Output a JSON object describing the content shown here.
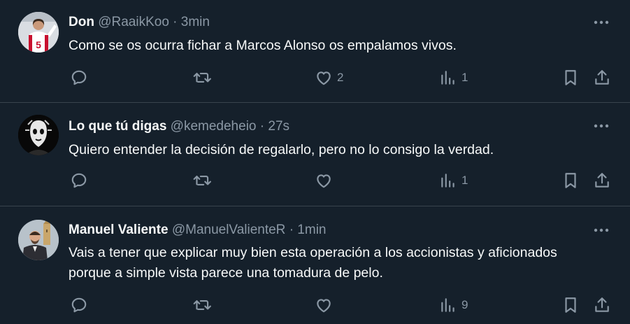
{
  "tweets": [
    {
      "name": "Don",
      "handle": "@RaaikKoo",
      "separator": "·",
      "time": "3min",
      "text": "Como se os ocurra fichar a Marcos Alonso os empalamos vivos.",
      "likes": "2",
      "views": "1"
    },
    {
      "name": "Lo que tú digas",
      "handle": "@kemedeheio",
      "separator": "·",
      "time": "27s",
      "text": "Quiero entender la decisión de regalarlo, pero no lo consigo la verdad.",
      "likes": "",
      "views": "1"
    },
    {
      "name": "Manuel Valiente",
      "handle": "@ManuelValienteR",
      "separator": "·",
      "time": "1min",
      "text": "Vais a tener que explicar muy bien esta operación a los accionistas y aficionados porque a simple vista parece una tomadura de pelo.",
      "likes": "",
      "views": "9"
    }
  ],
  "icons": {
    "reply": "reply-icon",
    "retweet": "retweet-icon",
    "like": "heart-icon",
    "views": "views-icon",
    "bookmark": "bookmark-icon",
    "share": "share-icon",
    "more": "more-icon"
  },
  "colors": {
    "background": "#15202b",
    "text": "#f7f9f9",
    "secondary": "#8b98a5",
    "divider": "#38444d"
  }
}
